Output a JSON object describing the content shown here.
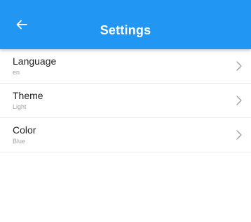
{
  "app_bar": {
    "title": "Settings",
    "back_icon": "arrow-left-icon",
    "color": "#2196f3"
  },
  "settings": [
    {
      "label": "Language",
      "value": "en",
      "icon": "chevron-right-icon"
    },
    {
      "label": "Theme",
      "value": "Light",
      "icon": "chevron-right-icon"
    },
    {
      "label": "Color",
      "value": "Blue",
      "icon": "chevron-right-icon"
    }
  ]
}
